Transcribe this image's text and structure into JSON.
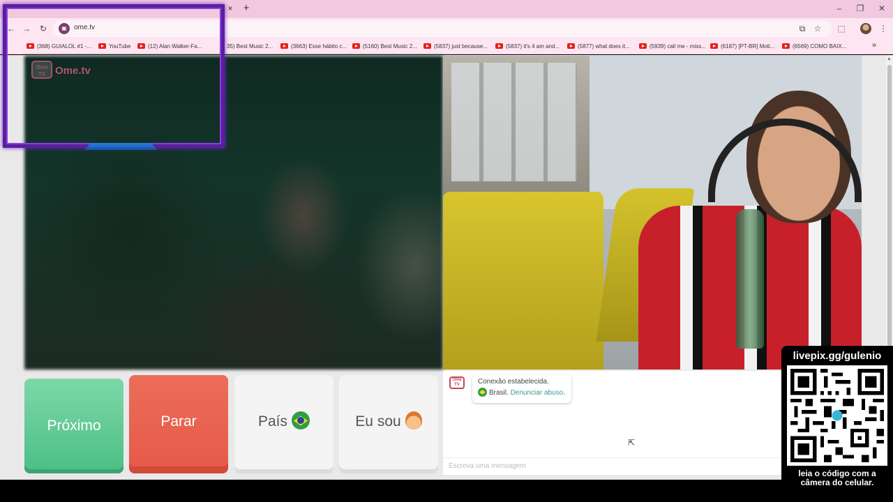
{
  "browser": {
    "url": "ome.tv",
    "tab_close": "×",
    "new_tab": "+",
    "window_controls": [
      "–",
      "❐",
      "✕"
    ],
    "nav_icons": [
      "back-icon",
      "forward-icon",
      "reload-icon"
    ],
    "toolbar_icons": [
      "cast-icon",
      "star-icon",
      "extensions-icon",
      "profile-avatar",
      "menu-icon"
    ],
    "bookmarks": [
      "(368) GUIALOL #1 -...",
      "YouTube",
      "(12) Alan Walker-Fa...",
      "35) Best Music 2...",
      "(3663) Esse hábito c...",
      "(5160) Best Music 2...",
      "(5837) just because...",
      "(5837) it's 4 am and...",
      "(5877) what does it...",
      "(5939) call me - miss...",
      "(6187) [PT-BR] Moti...",
      "(6569) COMO BAIX..."
    ],
    "bookmarks_more": "»"
  },
  "site": {
    "logo_box": "Ome TV",
    "logo_text": "Ome.tv"
  },
  "controls": {
    "next_label": "Próximo",
    "stop_label": "Parar",
    "country_label": "País",
    "iam_label": "Eu sou"
  },
  "chat": {
    "logo_box": "Ome TV",
    "status_message": "Conexão estabelecida.",
    "country": "Brasil.",
    "report_link": "Denunciar abuso",
    "report_suffix": ".",
    "input_placeholder": "Escreva uma mensagem"
  },
  "overlay": {
    "qr_title": "livepix.gg/gulenio",
    "qr_caption_line1": "leia o código com a",
    "qr_caption_line2": "câmera do celular."
  },
  "colors": {
    "next": "#5cc995",
    "stop": "#e8604e",
    "frame": "#5b1e9e",
    "tabstrip": "#f2c8e0"
  }
}
